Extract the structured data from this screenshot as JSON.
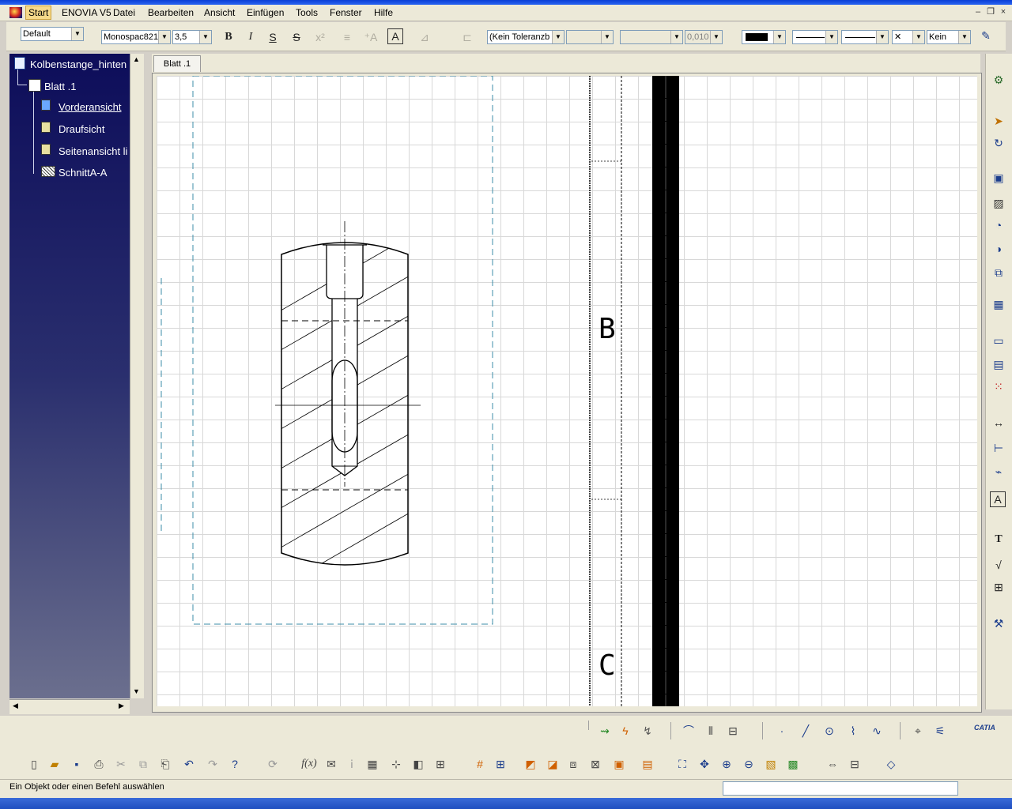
{
  "window": {
    "minimize": "–",
    "restore": "❐",
    "close": "×"
  },
  "menu": {
    "items": [
      "Start",
      "ENOVIA V5",
      "Datei",
      "Bearbeiten",
      "Ansicht",
      "Einfügen",
      "Tools",
      "Fenster",
      "Hilfe"
    ],
    "active": "Start"
  },
  "toolbar": {
    "style": "Default",
    "font": "Monospac821",
    "font_size": "3,5",
    "bold": "B",
    "italic": "I",
    "underline": "S",
    "strike": "S",
    "frame": "A",
    "tolerance": "(Kein Toleranzb",
    "tolerance_value": "0,010",
    "line_type": "Kein"
  },
  "tree": {
    "root": "Kolbenstange_hinten",
    "sheet": "Blatt .1",
    "views": [
      "Vorderansicht",
      "Draufsicht",
      "Seitenansicht li",
      "SchnittA-A"
    ],
    "selected": "Vorderansicht"
  },
  "tab": {
    "label": "Blatt .1"
  },
  "drawing": {
    "frame_letter_b": "B",
    "frame_letter_c": "C"
  },
  "status": {
    "message": "Ein Objekt oder einen Befehl auswählen"
  },
  "brand": {
    "logo_text": "CATIA"
  }
}
